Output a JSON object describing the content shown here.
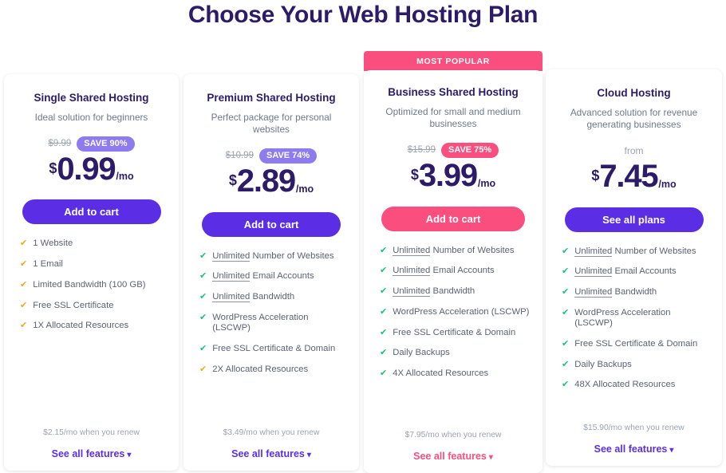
{
  "page": {
    "title": "Choose Your Web Hosting Plan",
    "colors": {
      "title": "#2d1b69",
      "purple": "#5b2ee5",
      "pink": "#fa4e7e",
      "badge_purple": "#8e7bf0",
      "check_green": "#19c27a",
      "check_orange": "#f2a71b",
      "muted": "#9aa3b0"
    }
  },
  "badges": {
    "most_popular": "MOST POPULAR"
  },
  "plans": [
    {
      "name": "Single Shared Hosting",
      "description": "Ideal solution for beginners",
      "old_price": "$9.99",
      "save_label": "SAVE 90%",
      "from_label": "",
      "currency": "$",
      "amount": "0.99",
      "per": "/mo",
      "cta_label": "Add to cart",
      "features": [
        {
          "text": "1 Website",
          "highlight": "",
          "check": "orange"
        },
        {
          "text": "1 Email",
          "highlight": "",
          "check": "orange"
        },
        {
          "text": "Limited Bandwidth (100 GB)",
          "highlight": "",
          "check": "orange"
        },
        {
          "text": "Free SSL Certificate",
          "highlight": "",
          "check": "orange"
        },
        {
          "text": "1X Allocated Resources",
          "highlight": "",
          "check": "orange"
        }
      ],
      "renew_note": "$2.15/mo when you renew",
      "see_all_label": "See all features"
    },
    {
      "name": "Premium Shared Hosting",
      "description": "Perfect package for personal websites",
      "old_price": "$10.99",
      "save_label": "SAVE 74%",
      "from_label": "",
      "currency": "$",
      "amount": "2.89",
      "per": "/mo",
      "cta_label": "Add to cart",
      "features": [
        {
          "text": "Number of Websites",
          "highlight": "Unlimited",
          "check": "green"
        },
        {
          "text": "Email Accounts",
          "highlight": "Unlimited",
          "check": "green"
        },
        {
          "text": "Bandwidth",
          "highlight": "Unlimited",
          "check": "green"
        },
        {
          "text": "WordPress Acceleration (LSCWP)",
          "highlight": "",
          "check": "green"
        },
        {
          "text": "Free SSL Certificate & Domain",
          "highlight": "",
          "check": "green"
        },
        {
          "text": "2X Allocated Resources",
          "highlight": "",
          "check": "orange"
        }
      ],
      "renew_note": "$3.49/mo when you renew",
      "see_all_label": "See all features"
    },
    {
      "name": "Business Shared Hosting",
      "description": "Optimized for small and medium businesses",
      "old_price": "$15.99",
      "save_label": "SAVE 75%",
      "from_label": "",
      "currency": "$",
      "amount": "3.99",
      "per": "/mo",
      "cta_label": "Add to cart",
      "features": [
        {
          "text": "Number of Websites",
          "highlight": "Unlimited",
          "check": "green"
        },
        {
          "text": "Email Accounts",
          "highlight": "Unlimited",
          "check": "green"
        },
        {
          "text": "Bandwidth",
          "highlight": "Unlimited",
          "check": "green"
        },
        {
          "text": "WordPress Acceleration (LSCWP)",
          "highlight": "",
          "check": "green"
        },
        {
          "text": "Free SSL Certificate & Domain",
          "highlight": "",
          "check": "green"
        },
        {
          "text": "Daily Backups",
          "highlight": "",
          "check": "green"
        },
        {
          "text": "4X Allocated Resources",
          "highlight": "",
          "check": "green"
        }
      ],
      "renew_note": "$7.95/mo when you renew",
      "see_all_label": "See all features"
    },
    {
      "name": "Cloud Hosting",
      "description": "Advanced solution for revenue generating businesses",
      "old_price": "",
      "save_label": "",
      "from_label": "from",
      "currency": "$",
      "amount": "7.45",
      "per": "/mo",
      "cta_label": "See all plans",
      "features": [
        {
          "text": "Number of Websites",
          "highlight": "Unlimited",
          "check": "green"
        },
        {
          "text": "Email Accounts",
          "highlight": "Unlimited",
          "check": "green"
        },
        {
          "text": "Bandwidth",
          "highlight": "Unlimited",
          "check": "green"
        },
        {
          "text": "WordPress Acceleration (LSCWP)",
          "highlight": "",
          "check": "green"
        },
        {
          "text": "Free SSL Certificate & Domain",
          "highlight": "",
          "check": "green"
        },
        {
          "text": "Daily Backups",
          "highlight": "",
          "check": "green"
        },
        {
          "text": "48X Allocated Resources",
          "highlight": "",
          "check": "green"
        }
      ],
      "renew_note": "$15.90/mo when you renew",
      "see_all_label": "See all features"
    }
  ]
}
